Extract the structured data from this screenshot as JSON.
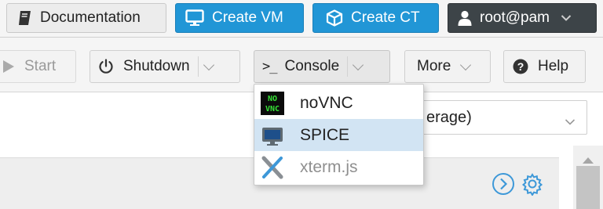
{
  "header": {
    "documentation_label": "Documentation",
    "create_vm_label": "Create VM",
    "create_ct_label": "Create CT",
    "user_label": "root@pam"
  },
  "toolbar": {
    "start_label": "Start",
    "shutdown_label": "Shutdown",
    "console_prompt_glyph": ">_",
    "console_label": "Console",
    "more_label": "More",
    "help_label": "Help"
  },
  "content": {
    "combo_value": "erage)"
  },
  "console_menu": {
    "items": [
      {
        "label": "noVNC",
        "icon_text": "NO VNC",
        "enabled": true,
        "highlighted": false
      },
      {
        "label": "SPICE",
        "enabled": true,
        "highlighted": true
      },
      {
        "label": "xterm.js",
        "enabled": false,
        "highlighted": false
      }
    ]
  },
  "colors": {
    "accent_blue": "#2196d6",
    "user_button": "#3d4448",
    "menu_highlight": "#d2e4f3",
    "novnc_green": "#36e236"
  }
}
